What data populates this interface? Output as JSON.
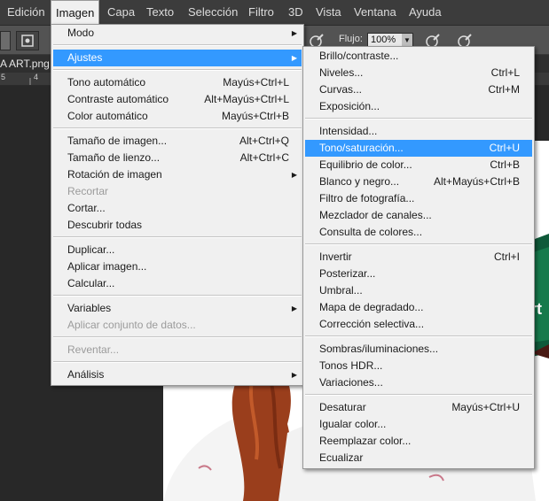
{
  "menubar": {
    "items": [
      "Edición",
      "Imagen",
      "Capa",
      "Texto",
      "Selección",
      "Filtro",
      "3D",
      "Vista",
      "Ventana",
      "Ayuda"
    ],
    "active": "Imagen"
  },
  "options": {
    "flujo_label": "Flujo:",
    "flujo_value": "100%"
  },
  "document": {
    "tab_title": "A ART.png",
    "ruler": [
      "5",
      "4"
    ],
    "artwork_text": "rt"
  },
  "imagen_menu": {
    "items": [
      {
        "label": "Modo",
        "shortcut": "",
        "submenu": true
      },
      {
        "sep": true
      },
      {
        "label": "Ajustes",
        "shortcut": "",
        "submenu": true,
        "highlighted": true
      },
      {
        "sep": true
      },
      {
        "label": "Tono automático",
        "shortcut": "Mayús+Ctrl+L"
      },
      {
        "label": "Contraste automático",
        "shortcut": "Alt+Mayús+Ctrl+L"
      },
      {
        "label": "Color automático",
        "shortcut": "Mayús+Ctrl+B"
      },
      {
        "sep": true
      },
      {
        "label": "Tamaño de imagen...",
        "shortcut": "Alt+Ctrl+Q"
      },
      {
        "label": "Tamaño de lienzo...",
        "shortcut": "Alt+Ctrl+C"
      },
      {
        "label": "Rotación de imagen",
        "shortcut": "",
        "submenu": true
      },
      {
        "label": "Recortar",
        "shortcut": "",
        "disabled": true
      },
      {
        "label": "Cortar...",
        "shortcut": ""
      },
      {
        "label": "Descubrir todas",
        "shortcut": ""
      },
      {
        "sep": true
      },
      {
        "label": "Duplicar...",
        "shortcut": ""
      },
      {
        "label": "Aplicar imagen...",
        "shortcut": ""
      },
      {
        "label": "Calcular...",
        "shortcut": ""
      },
      {
        "sep": true
      },
      {
        "label": "Variables",
        "shortcut": "",
        "submenu": true
      },
      {
        "label": "Aplicar conjunto de datos...",
        "shortcut": "",
        "disabled": true
      },
      {
        "sep": true
      },
      {
        "label": "Reventar...",
        "shortcut": "",
        "disabled": true
      },
      {
        "sep": true
      },
      {
        "label": "Análisis",
        "shortcut": "",
        "submenu": true
      }
    ]
  },
  "ajustes_menu": {
    "items": [
      {
        "label": "Brillo/contraste...",
        "shortcut": ""
      },
      {
        "label": "Niveles...",
        "shortcut": "Ctrl+L"
      },
      {
        "label": "Curvas...",
        "shortcut": "Ctrl+M"
      },
      {
        "label": "Exposición...",
        "shortcut": ""
      },
      {
        "sep": true
      },
      {
        "label": "Intensidad...",
        "shortcut": ""
      },
      {
        "label": "Tono/saturación...",
        "shortcut": "Ctrl+U",
        "highlighted": true
      },
      {
        "label": "Equilibrio de color...",
        "shortcut": "Ctrl+B"
      },
      {
        "label": "Blanco y negro...",
        "shortcut": "Alt+Mayús+Ctrl+B"
      },
      {
        "label": "Filtro de fotografía...",
        "shortcut": ""
      },
      {
        "label": "Mezclador de canales...",
        "shortcut": ""
      },
      {
        "label": "Consulta de colores...",
        "shortcut": ""
      },
      {
        "sep": true
      },
      {
        "label": "Invertir",
        "shortcut": "Ctrl+I"
      },
      {
        "label": "Posterizar...",
        "shortcut": ""
      },
      {
        "label": "Umbral...",
        "shortcut": ""
      },
      {
        "label": "Mapa de degradado...",
        "shortcut": ""
      },
      {
        "label": "Corrección selectiva...",
        "shortcut": ""
      },
      {
        "sep": true
      },
      {
        "label": "Sombras/iluminaciones...",
        "shortcut": ""
      },
      {
        "label": "Tonos HDR...",
        "shortcut": ""
      },
      {
        "label": "Variaciones...",
        "shortcut": ""
      },
      {
        "sep": true
      },
      {
        "label": "Desaturar",
        "shortcut": "Mayús+Ctrl+U"
      },
      {
        "label": "Igualar color...",
        "shortcut": ""
      },
      {
        "label": "Reemplazar color...",
        "shortcut": ""
      },
      {
        "label": "Ecualizar",
        "shortcut": ""
      }
    ]
  }
}
